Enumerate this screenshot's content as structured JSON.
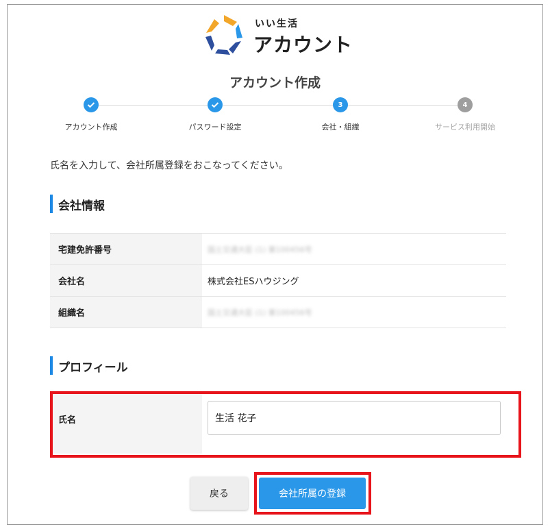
{
  "logo": {
    "sub": "いい生活",
    "main": "アカウント"
  },
  "page_title": "アカウント作成",
  "steps": [
    {
      "label": "アカウント作成",
      "status": "done"
    },
    {
      "label": "パスワード設定",
      "status": "done"
    },
    {
      "label": "会社・組織",
      "number": "3",
      "status": "current"
    },
    {
      "label": "サービス利用開始",
      "number": "4",
      "status": "todo"
    }
  ],
  "intro": "氏名を入力して、会社所属登録をおこなってください。",
  "company_section": {
    "heading": "会社情報",
    "rows": [
      {
        "label": "宅建免許番号",
        "value": "国土交通大臣 (1) 第100456号",
        "blurred": true
      },
      {
        "label": "会社名",
        "value": "株式会社ESハウジング",
        "blurred": false
      },
      {
        "label": "組織名",
        "value": "国土交通大臣 (1) 第100456号",
        "blurred": true
      }
    ]
  },
  "profile_section": {
    "heading": "プロフィール",
    "name_label": "氏名",
    "name_value": "生活 花子"
  },
  "buttons": {
    "back": "戻る",
    "submit": "会社所属の登録"
  },
  "colors": {
    "accent": "#2a97e8",
    "highlight": "#e8141b",
    "pending": "#9e9e9e"
  }
}
